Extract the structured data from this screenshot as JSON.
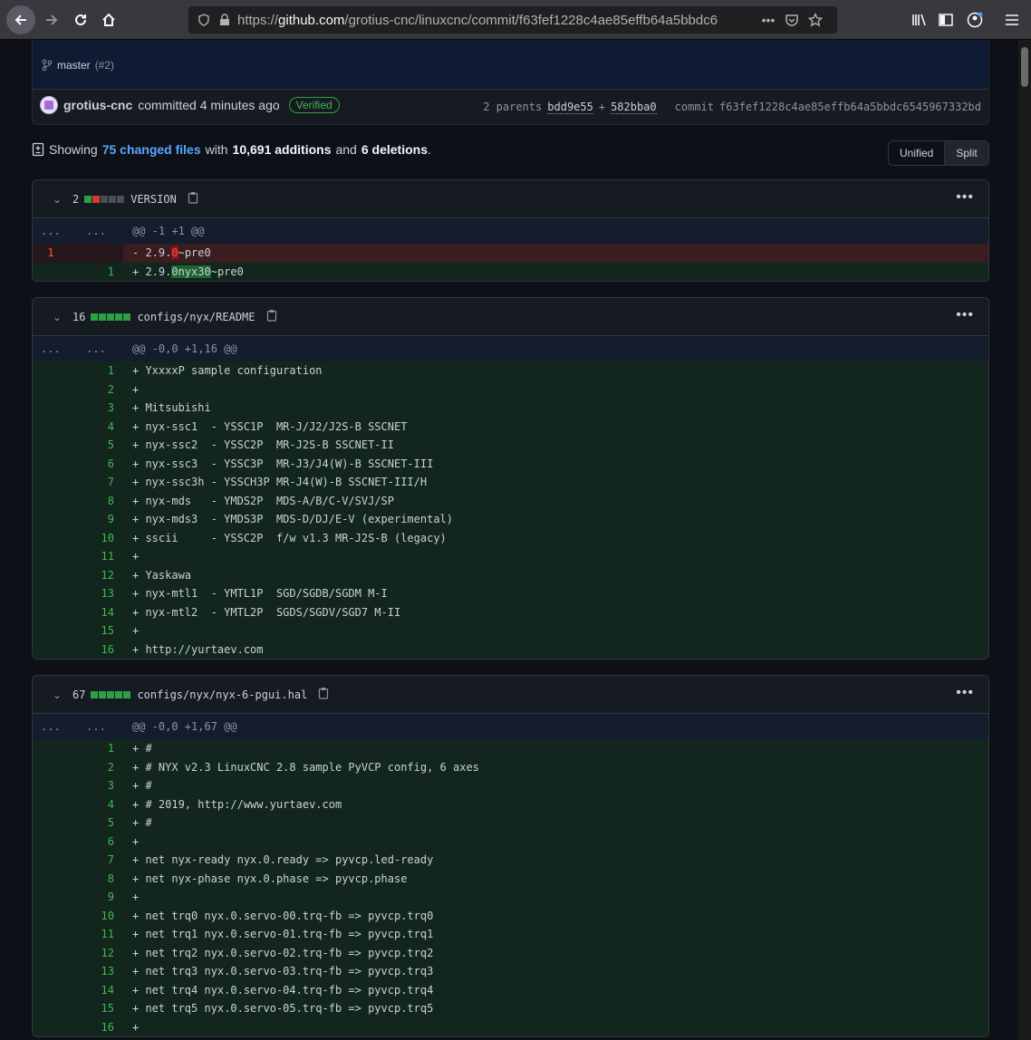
{
  "browser": {
    "url_prefix": "https://",
    "url_domain": "github.com",
    "url_path": "/grotius-cnc/linuxcnc/commit/f63fef1228c4ae85effb64a5bbdc6",
    "more_icon": "more-horizontal-icon"
  },
  "commit": {
    "branch": "master",
    "pr": "(#2)",
    "author": "grotius-cnc",
    "action": "committed 4 minutes ago",
    "verified": "Verified",
    "parents_label": "2 parents",
    "parent1": "bdd9e55",
    "plus": "+",
    "parent2": "582bba0",
    "commit_label": "commit",
    "sha": "f63fef1228c4ae85effb64a5bbdc6545967332bd"
  },
  "summary": {
    "showing": "Showing",
    "changed": "75 changed files",
    "with": "with",
    "additions": "10,691 additions",
    "and": "and",
    "deletions": "6 deletions",
    "period": "."
  },
  "view_toggle": {
    "unified": "Unified",
    "split": "Split"
  },
  "files": [
    {
      "count": "2",
      "name": "VERSION",
      "hunk": "@@ -1 +1 @@",
      "rows": [
        {
          "type": "del",
          "old": "1",
          "new": "",
          "pre": "- 2.9.",
          "hl": "0",
          "post": "~pre0"
        },
        {
          "type": "add",
          "old": "",
          "new": "1",
          "pre": "+ 2.9.",
          "hl": "0nyx30",
          "post": "~pre0"
        }
      ]
    },
    {
      "count": "16",
      "name": "configs/nyx/README",
      "hunk": "@@ -0,0 +1,16 @@",
      "rows": [
        {
          "new": "1",
          "text": "+ YxxxxP sample configuration"
        },
        {
          "new": "2",
          "text": "+"
        },
        {
          "new": "3",
          "text": "+ Mitsubishi"
        },
        {
          "new": "4",
          "text": "+ nyx-ssc1  - YSSC1P  MR-J/J2/J2S-B SSCNET"
        },
        {
          "new": "5",
          "text": "+ nyx-ssc2  - YSSC2P  MR-J2S-B SSCNET-II"
        },
        {
          "new": "6",
          "text": "+ nyx-ssc3  - YSSC3P  MR-J3/J4(W)-B SSCNET-III"
        },
        {
          "new": "7",
          "text": "+ nyx-ssc3h - YSSCH3P MR-J4(W)-B SSCNET-III/H"
        },
        {
          "new": "8",
          "text": "+ nyx-mds   - YMDS2P  MDS-A/B/C-V/SVJ/SP"
        },
        {
          "new": "9",
          "text": "+ nyx-mds3  - YMDS3P  MDS-D/DJ/E-V (experimental)"
        },
        {
          "new": "10",
          "text": "+ sscii     - YSSC2P  f/w v1.3 MR-J2S-B (legacy)"
        },
        {
          "new": "11",
          "text": "+"
        },
        {
          "new": "12",
          "text": "+ Yaskawa"
        },
        {
          "new": "13",
          "text": "+ nyx-mtl1  - YMTL1P  SGD/SGDB/SGDM M-I"
        },
        {
          "new": "14",
          "text": "+ nyx-mtl2  - YMTL2P  SGDS/SGDV/SGD7 M-II"
        },
        {
          "new": "15",
          "text": "+"
        },
        {
          "new": "16",
          "text": "+ http://yurtaev.com"
        }
      ]
    },
    {
      "count": "67",
      "name": "configs/nyx/nyx-6-pgui.hal",
      "hunk": "@@ -0,0 +1,67 @@",
      "rows": [
        {
          "new": "1",
          "text": "+ #"
        },
        {
          "new": "2",
          "text": "+ # NYX v2.3 LinuxCNC 2.8 sample PyVCP config, 6 axes"
        },
        {
          "new": "3",
          "text": "+ #"
        },
        {
          "new": "4",
          "text": "+ # 2019, http://www.yurtaev.com"
        },
        {
          "new": "5",
          "text": "+ #"
        },
        {
          "new": "6",
          "text": "+"
        },
        {
          "new": "7",
          "text": "+ net nyx-ready nyx.0.ready => pyvcp.led-ready"
        },
        {
          "new": "8",
          "text": "+ net nyx-phase nyx.0.phase => pyvcp.phase"
        },
        {
          "new": "9",
          "text": "+"
        },
        {
          "new": "10",
          "text": "+ net trq0 nyx.0.servo-00.trq-fb => pyvcp.trq0"
        },
        {
          "new": "11",
          "text": "+ net trq1 nyx.0.servo-01.trq-fb => pyvcp.trq1"
        },
        {
          "new": "12",
          "text": "+ net trq2 nyx.0.servo-02.trq-fb => pyvcp.trq2"
        },
        {
          "new": "13",
          "text": "+ net trq3 nyx.0.servo-03.trq-fb => pyvcp.trq3"
        },
        {
          "new": "14",
          "text": "+ net trq4 nyx.0.servo-04.trq-fb => pyvcp.trq4"
        },
        {
          "new": "15",
          "text": "+ net trq5 nyx.0.servo-05.trq-fb => pyvcp.trq5"
        },
        {
          "new": "16",
          "text": "+"
        }
      ]
    }
  ],
  "hunk_dots": "...",
  "colors": {
    "add": "#2ea043",
    "del": "#da3633",
    "link": "#58a6ff"
  }
}
